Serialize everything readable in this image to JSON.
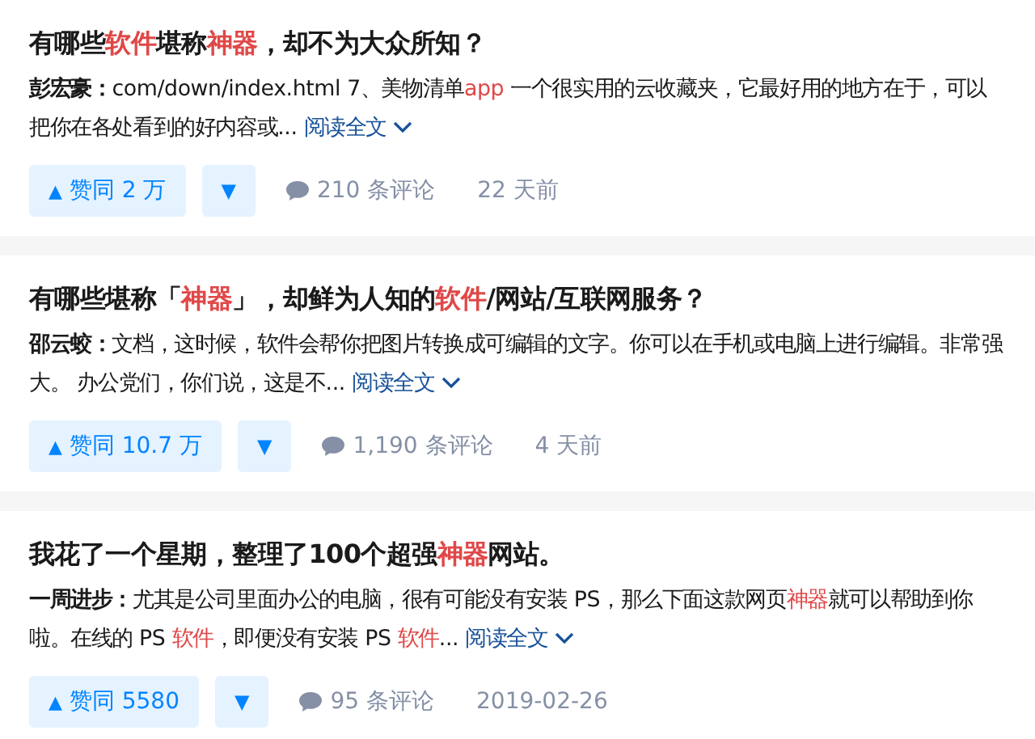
{
  "answers": [
    {
      "title": [
        {
          "text": "有哪些",
          "highlight": false
        },
        {
          "text": "软件",
          "highlight": true
        },
        {
          "text": "堪称",
          "highlight": false
        },
        {
          "text": "神器",
          "highlight": true
        },
        {
          "text": "，却不为大众所知？",
          "highlight": false
        }
      ],
      "author": "彭宏豪：",
      "excerpt": [
        {
          "text": "com/down/index.html 7、美物清单",
          "highlight": false
        },
        {
          "text": "app",
          "highlight": true
        },
        {
          "text": " 一个很实用的云收藏夹，它最好用的地方在于，可以把你在各处看到的好内容或...",
          "highlight": false
        }
      ],
      "read_more": "阅读全文",
      "vote_up": "▲",
      "votes": "赞同 2 万",
      "vote_down": "▼",
      "comments": "210 条评论",
      "time": "22 天前"
    },
    {
      "title": [
        {
          "text": "有哪些堪称「",
          "highlight": false
        },
        {
          "text": "神器",
          "highlight": true
        },
        {
          "text": "」，却鲜为人知的",
          "highlight": false
        },
        {
          "text": "软件",
          "highlight": true
        },
        {
          "text": "/网站/互联网服务？",
          "highlight": false
        }
      ],
      "author": "邵云蛟：",
      "excerpt": [
        {
          "text": "文档，这时候，软件会帮你把图片转换成可编辑的文字。你可以在手机或电脑上进行编辑。非常强大。 办公党们，你们说，这是不...",
          "highlight": false
        }
      ],
      "read_more": "阅读全文",
      "vote_up": "▲",
      "votes": "赞同 10.7 万",
      "vote_down": "▼",
      "comments": "1,190 条评论",
      "time": "4 天前"
    },
    {
      "title": [
        {
          "text": "我花了一个星期，整理了100个超强",
          "highlight": false
        },
        {
          "text": "神器",
          "highlight": true
        },
        {
          "text": "网站。",
          "highlight": false
        }
      ],
      "author": "一周进步：",
      "excerpt": [
        {
          "text": "尤其是公司里面办公的电脑，很有可能没有安装 PS，那么下面这款网页",
          "highlight": false
        },
        {
          "text": "神器",
          "highlight": true
        },
        {
          "text": "就可以帮助到你啦。在线的 PS ",
          "highlight": false
        },
        {
          "text": "软件",
          "highlight": true
        },
        {
          "text": "，即便没有安装 PS ",
          "highlight": false
        },
        {
          "text": "软件",
          "highlight": true
        },
        {
          "text": "...",
          "highlight": false
        }
      ],
      "read_more": "阅读全文",
      "vote_up": "▲",
      "votes": "赞同 5580",
      "vote_down": "▼",
      "comments": "95 条评论",
      "time": "2019-02-26"
    }
  ]
}
